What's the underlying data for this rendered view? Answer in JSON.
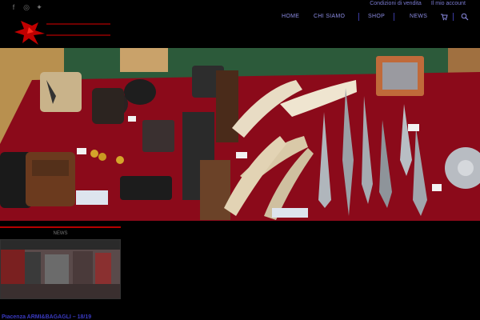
{
  "header": {
    "social": [
      "facebook-icon",
      "instagram-icon",
      "twitter-icon"
    ],
    "util_links": [
      "Condizioni di vendita",
      "Il mio account"
    ],
    "nav": {
      "home": "HOME",
      "chi_siamo": "CHI SIAMO",
      "shop": "SHOP",
      "news": "NEWS"
    },
    "nav_icons": [
      "cart-icon",
      "search-icon"
    ]
  },
  "news_card": {
    "label": "NEWS",
    "title": "Piacenza ARMI&BAGAGLI – 18/19"
  },
  "colors": {
    "accent_red": "#b40000",
    "nav_blue": "#8a8ae0",
    "background": "#000000",
    "tablecloth": "#8b0a1a"
  }
}
